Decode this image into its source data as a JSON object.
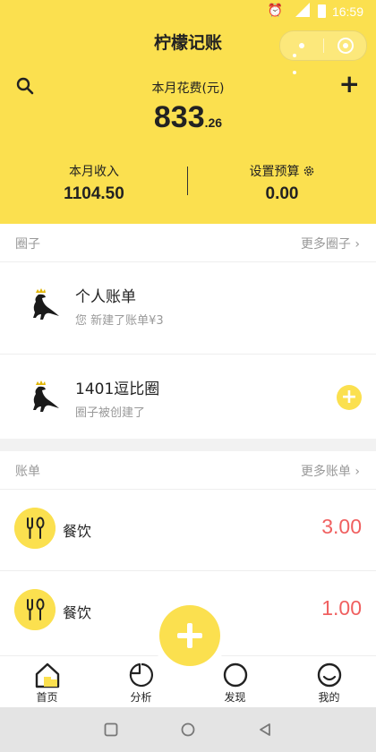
{
  "status_bar": {
    "time": "16:59",
    "network": "4G"
  },
  "app": {
    "title": "柠檬记账"
  },
  "header": {
    "spend_label": "本月花费(元)",
    "spend_integer": "833",
    "spend_decimal": ".26",
    "income_label": "本月收入",
    "income_value": "1104.50",
    "budget_label": "设置预算",
    "budget_value": "0.00"
  },
  "circles": {
    "title": "圈子",
    "more_label": "更多圈子",
    "items": [
      {
        "name": "个人账单",
        "subtitle": "您 新建了账单¥3"
      },
      {
        "name": "1401逗比圈",
        "subtitle": "圈子被创建了"
      }
    ]
  },
  "bills": {
    "title": "账单",
    "more_label": "更多账单",
    "items": [
      {
        "category": "餐饮",
        "amount": "3.00"
      },
      {
        "category": "餐饮",
        "amount": "1.00"
      }
    ]
  },
  "tabbar": {
    "items": [
      {
        "label": "首页"
      },
      {
        "label": "分析"
      },
      {
        "label": "发现"
      },
      {
        "label": "我的"
      }
    ]
  },
  "colors": {
    "brand": "#fbe04f",
    "amount": "#f06060",
    "muted": "#999999"
  },
  "icons": [
    "search-icon",
    "plus-icon",
    "gear-icon",
    "more-icon",
    "target-icon",
    "home-icon",
    "analysis-icon",
    "discover-icon",
    "profile-icon",
    "utensils-icon"
  ]
}
